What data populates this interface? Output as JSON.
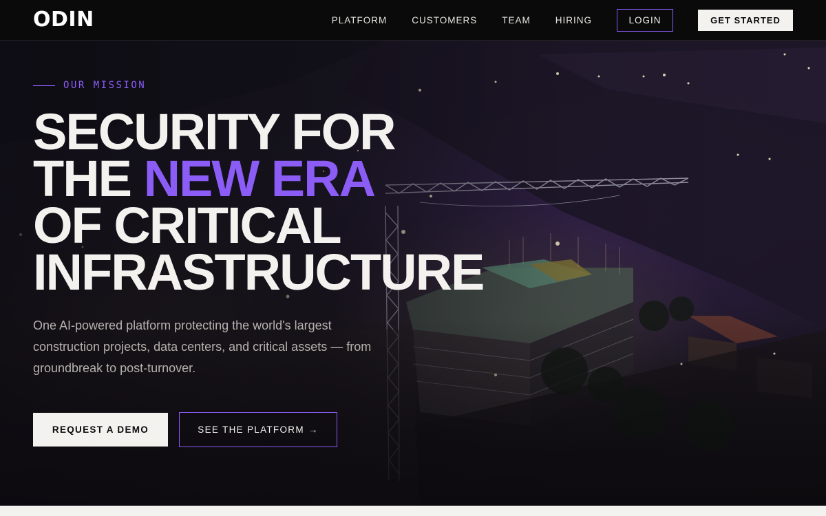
{
  "nav": {
    "logo": "ODIN",
    "links": [
      "PLATFORM",
      "CUSTOMERS",
      "TEAM",
      "HIRING"
    ],
    "login_label": "LOGIN",
    "cta_label": "GET STARTED"
  },
  "hero": {
    "eyebrow": "OUR MISSION",
    "headline": {
      "line1": "SECURITY FOR",
      "line2_prefix": "THE ",
      "line2_accent": "NEW ERA",
      "line3": "OF CRITICAL",
      "line4": "INFRASTRUCTURE"
    },
    "subtext": "One AI-powered platform protecting the world's largest construction projects, data centers, and critical assets — from groundbreak to post-turnover.",
    "primary_cta": "REQUEST A DEMO",
    "secondary_cta": "SEE THE PLATFORM",
    "secondary_cta_arrow": "→",
    "background_image": "night-construction-site-aerial"
  },
  "colors": {
    "accent": "#8b5cf6",
    "background": "#0a0a0b",
    "light": "#f3f2ee"
  }
}
